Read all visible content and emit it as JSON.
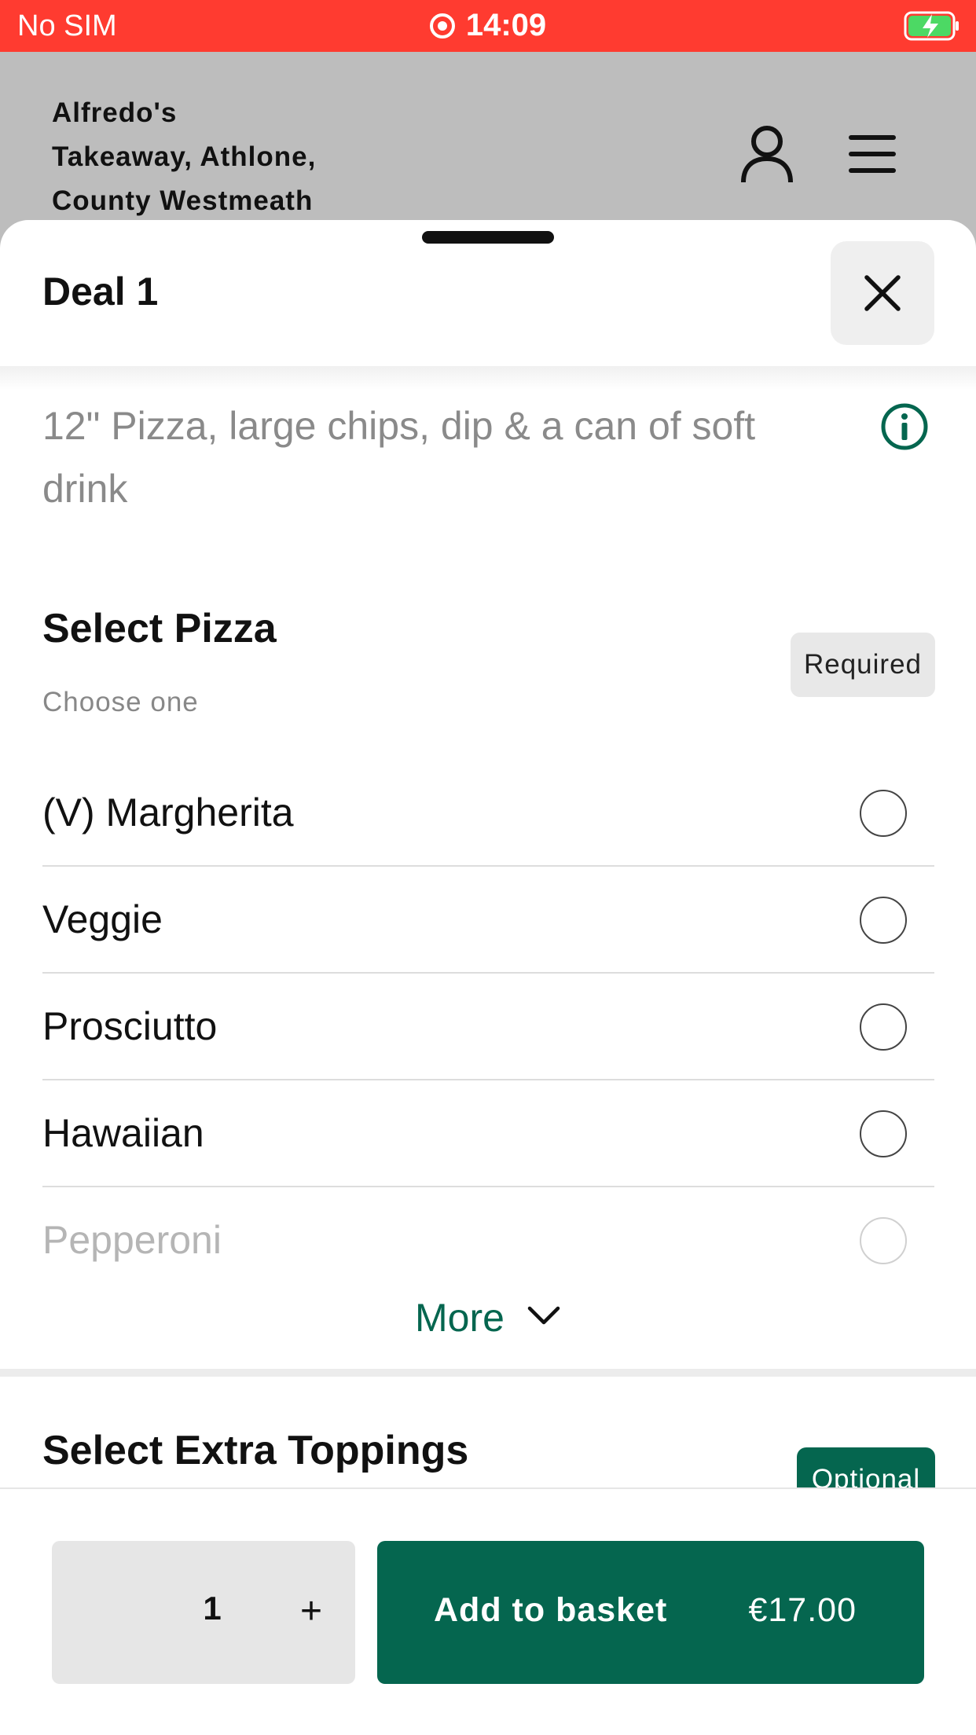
{
  "status_bar": {
    "carrier": "No SIM",
    "time": "14:09"
  },
  "header": {
    "restaurant_name": "Alfredo's\nTakeaway, Athlone,\nCounty Westmeath"
  },
  "sheet": {
    "title": "Deal 1",
    "description": "12\" Pizza, large chips, dip & a can of soft drink"
  },
  "pizza_section": {
    "title": "Select Pizza",
    "subtitle": "Choose one",
    "badge": "Required",
    "options": [
      {
        "label": "(V) Margherita"
      },
      {
        "label": "Veggie"
      },
      {
        "label": "Prosciutto"
      },
      {
        "label": "Hawaiian"
      },
      {
        "label": "Pepperoni"
      }
    ],
    "more_label": "More"
  },
  "toppings_section": {
    "title": "Select Extra Toppings",
    "badge": "Optional"
  },
  "bottom_bar": {
    "quantity": "1",
    "plus_label": "+",
    "add_label": "Add to basket",
    "price": "€17.00"
  },
  "colors": {
    "status_bar": "#ff3b30",
    "brand_green": "#05664f",
    "header_bg": "#bdbdbd"
  }
}
